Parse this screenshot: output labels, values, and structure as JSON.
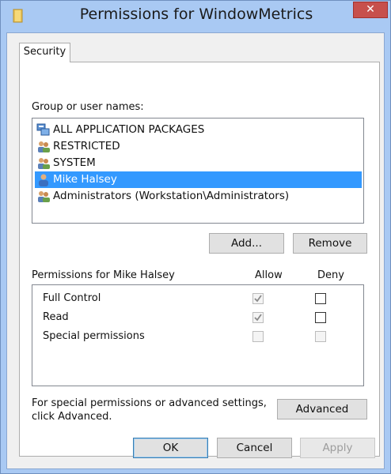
{
  "window": {
    "title": "Permissions for WindowMetrics",
    "close_glyph": "✕"
  },
  "tabs": [
    {
      "label": "Security"
    }
  ],
  "group_label": "Group or user names:",
  "users": [
    {
      "name": "ALL APPLICATION PACKAGES",
      "icon": "app-packages-icon",
      "selected": false
    },
    {
      "name": "RESTRICTED",
      "icon": "group-icon",
      "selected": false
    },
    {
      "name": "SYSTEM",
      "icon": "group-icon",
      "selected": false
    },
    {
      "name": "Mike Halsey",
      "icon": "user-icon",
      "selected": true
    },
    {
      "name": "Administrators (Workstation\\Administrators)",
      "icon": "group-icon",
      "selected": false
    }
  ],
  "buttons": {
    "add": "Add...",
    "remove": "Remove",
    "advanced": "Advanced",
    "ok": "OK",
    "cancel": "Cancel",
    "apply": "Apply"
  },
  "permissions": {
    "header": "Permissions for Mike Halsey",
    "allow_label": "Allow",
    "deny_label": "Deny",
    "rows": [
      {
        "name": "Full Control",
        "allow": "checked-disabled",
        "deny": "unchecked"
      },
      {
        "name": "Read",
        "allow": "checked-disabled",
        "deny": "unchecked"
      },
      {
        "name": "Special permissions",
        "allow": "disabled",
        "deny": "disabled"
      }
    ]
  },
  "advanced_note_line1": "For special permissions or advanced settings,",
  "advanced_note_line2": "click Advanced.",
  "colors": {
    "selection": "#3399ff",
    "close_button": "#c7504c",
    "frame": "#a9c9f3"
  }
}
